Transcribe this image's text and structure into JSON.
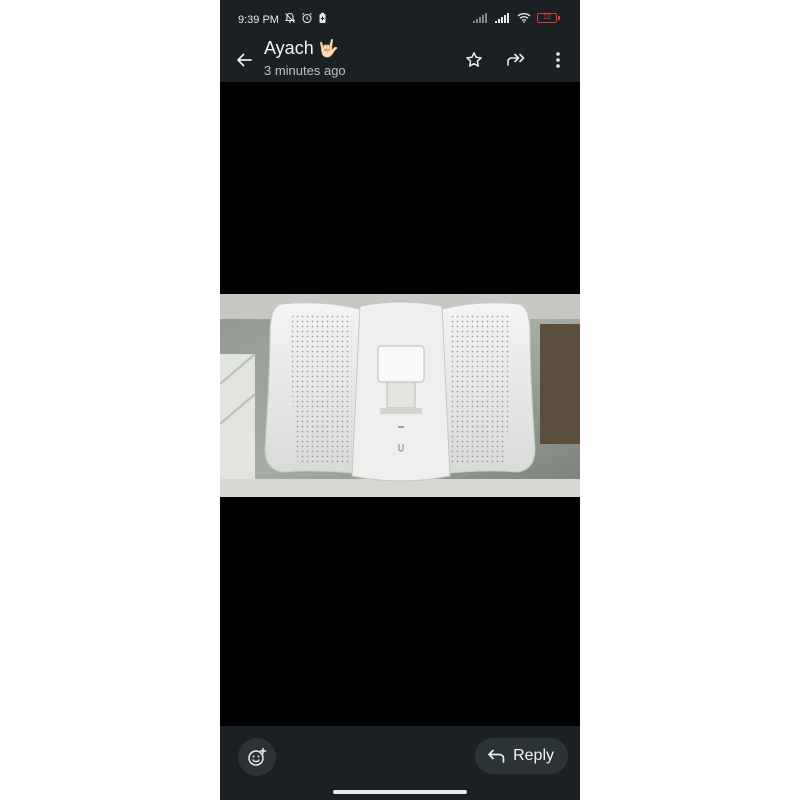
{
  "status_bar": {
    "time": "9:39 PM",
    "left_icons": [
      "mute-bell-icon",
      "alarm-icon",
      "battery-saver-icon"
    ],
    "right_icons": [
      "signal-icon",
      "signal-icon",
      "wifi-icon",
      "battery-icon"
    ],
    "battery_level": "12",
    "battery_color": "#e53935"
  },
  "header": {
    "title": "Ayach",
    "title_emoji": "🤟🏻",
    "subtitle": "3 minutes ago",
    "actions": [
      "star-icon",
      "forward-icon",
      "more-vert-icon"
    ]
  },
  "footer": {
    "emoji_button_icon": "add-emoji-icon",
    "reply_label": "Reply",
    "reply_icon": "reply-icon"
  },
  "colors": {
    "bar_background": "#1a2024",
    "button_background": "#2b3337",
    "text": "#e8eaed"
  }
}
